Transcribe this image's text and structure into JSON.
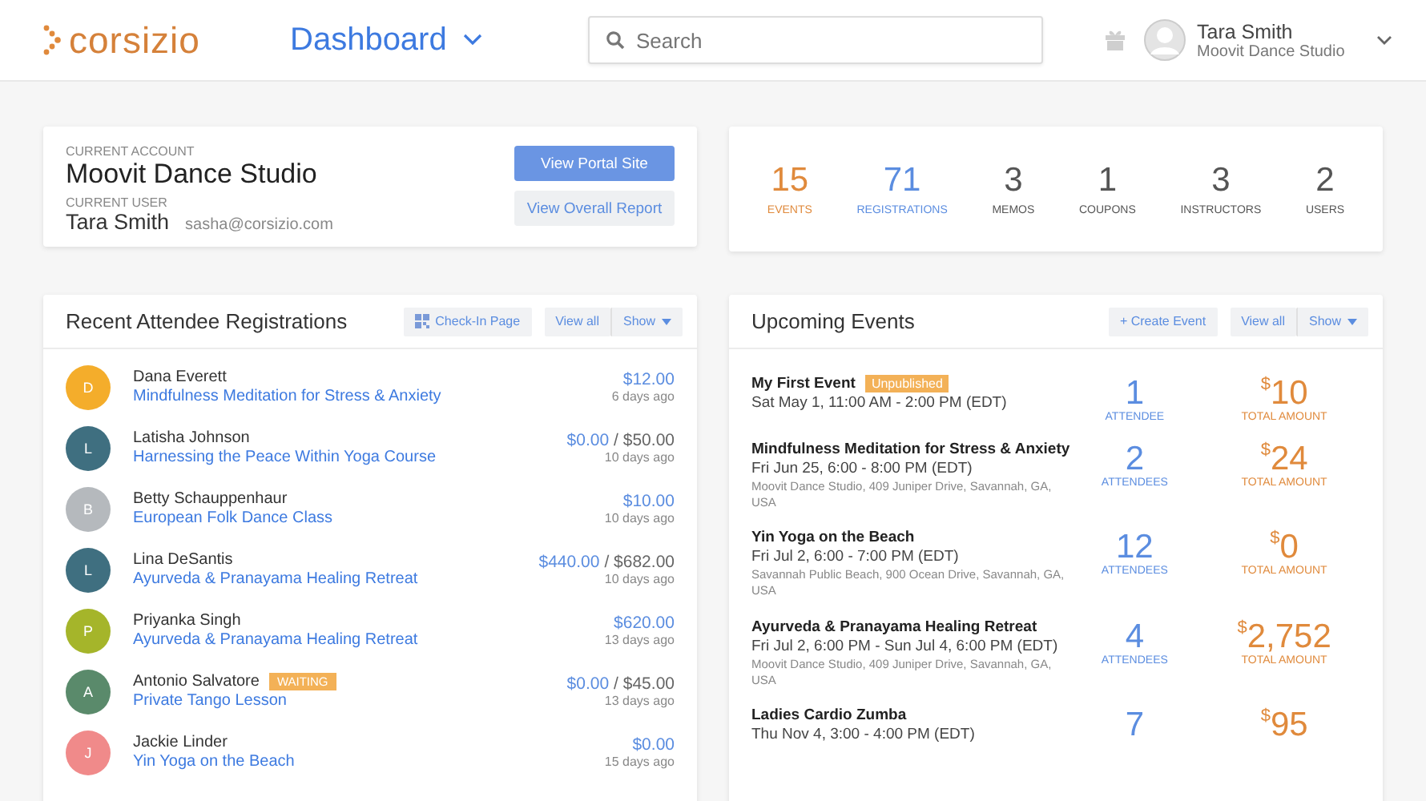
{
  "header": {
    "logo": "corsizio",
    "title": "Dashboard",
    "search": {
      "placeholder": "Search"
    },
    "user": {
      "name": "Tara Smith",
      "org": "Moovit Dance Studio"
    }
  },
  "account": {
    "account_label": "CURRENT ACCOUNT",
    "account": "Moovit Dance Studio",
    "user_label": "CURRENT USER",
    "user": "Tara Smith",
    "email": "sasha@corsizio.com",
    "buttons": [
      {
        "label": "View Portal Site",
        "kind": "primary"
      },
      {
        "label": "View Overall Report",
        "kind": "secondary"
      }
    ]
  },
  "stats": [
    {
      "value": "15",
      "label": "EVENTS",
      "color": "#e08a3c"
    },
    {
      "value": "71",
      "label": "REGISTRATIONS",
      "color": "#5b8de0"
    },
    {
      "value": "3",
      "label": "MEMOS",
      "color": "#555555"
    },
    {
      "value": "1",
      "label": "COUPONS",
      "color": "#555555"
    },
    {
      "value": "3",
      "label": "INSTRUCTORS",
      "color": "#555555"
    },
    {
      "value": "2",
      "label": "USERS",
      "color": "#555555"
    }
  ],
  "registrations": {
    "title": "Recent Attendee Registrations",
    "checkin": "Check-In Page",
    "view_all": "View all",
    "show": "Show",
    "items": [
      {
        "initial": "D",
        "color": "#f4ad2b",
        "name": "Dana Everett",
        "event": "Mindfulness Meditation for Stress & Anxiety",
        "paid": "$12.00",
        "when": "6 days ago"
      },
      {
        "initial": "L",
        "color": "#3f6f80",
        "name": "Latisha Johnson",
        "event": "Harnessing the Peace Within Yoga Course",
        "paid": "$0.00",
        "total": "/ $50.00",
        "when": "10 days ago"
      },
      {
        "initial": "B",
        "color": "#b5b9bd",
        "name": "Betty Schauppenhaur",
        "event": "European Folk Dance Class",
        "paid": "$10.00",
        "when": "10 days ago"
      },
      {
        "initial": "L",
        "color": "#3f6f80",
        "name": "Lina DeSantis",
        "event": "Ayurveda & Pranayama Healing Retreat",
        "paid": "$440.00",
        "total": "/ $682.00",
        "when": "10 days ago"
      },
      {
        "initial": "P",
        "color": "#a5b52a",
        "name": "Priyanka Singh",
        "event": "Ayurveda & Pranayama Healing Retreat",
        "paid": "$620.00",
        "when": "13 days ago"
      },
      {
        "initial": "A",
        "color": "#5a8a6b",
        "name": "Antonio Salvatore",
        "badge": "WAITING",
        "event": "Private Tango Lesson",
        "paid": "$0.00",
        "total": "/ $45.00",
        "when": "13 days ago"
      },
      {
        "initial": "J",
        "color": "#f08a8a",
        "name": "Jackie Linder",
        "event": "Yin Yoga on the Beach",
        "paid": "$0.00",
        "when": "15 days ago"
      }
    ]
  },
  "events": {
    "title": "Upcoming Events",
    "create": "+ Create Event",
    "view_all": "View all",
    "show": "Show",
    "items": [
      {
        "name": "My First Event",
        "badge": "Unpublished",
        "when": "Sat May 1, 11:00 AM - 2:00 PM (EDT)",
        "attendees": "1",
        "attendees_label": "ATTENDEE",
        "currency": "$",
        "amount": "10",
        "amount_label": "TOTAL AMOUNT"
      },
      {
        "name": "Mindfulness Meditation for Stress & Anxiety",
        "when": "Fri Jun 25, 6:00 - 8:00 PM (EDT)",
        "place": "Moovit Dance Studio, 409 Juniper Drive, Savannah, GA, USA",
        "attendees": "2",
        "attendees_label": "ATTENDEES",
        "currency": "$",
        "amount": "24",
        "amount_label": "TOTAL AMOUNT"
      },
      {
        "name": "Yin Yoga on the Beach",
        "when": "Fri Jul 2, 6:00 - 7:00 PM (EDT)",
        "place": "Savannah Public Beach, 900 Ocean Drive, Savannah, GA, USA",
        "attendees": "12",
        "attendees_label": "ATTENDEES",
        "currency": "$",
        "amount": "0",
        "amount_label": "TOTAL AMOUNT"
      },
      {
        "name": "Ayurveda & Pranayama Healing Retreat",
        "when": "Fri Jul 2, 6:00 PM - Sun Jul 4, 6:00 PM (EDT)",
        "place": "Moovit Dance Studio, 409 Juniper Drive, Savannah, GA, USA",
        "attendees": "4",
        "attendees_label": "ATTENDEES",
        "currency": "$",
        "amount": "2,752",
        "amount_label": "TOTAL AMOUNT"
      },
      {
        "name": "Ladies Cardio Zumba",
        "when": "Thu Nov 4, 3:00 - 4:00 PM (EDT)",
        "attendees": "7",
        "currency": "$",
        "amount": "95"
      }
    ]
  }
}
